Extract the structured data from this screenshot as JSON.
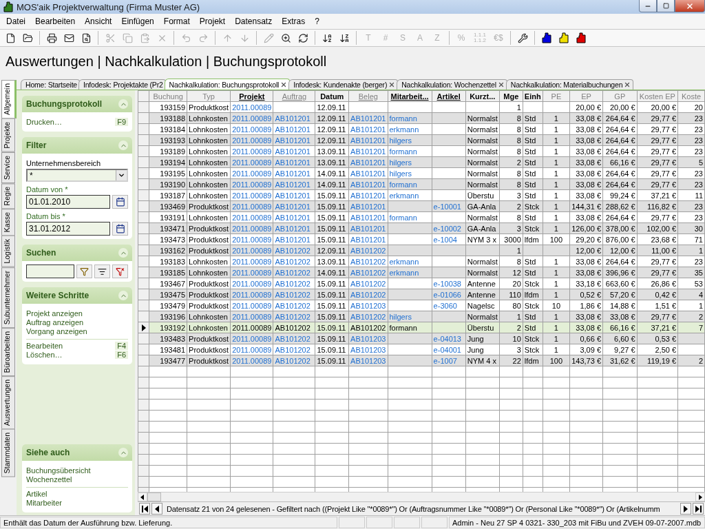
{
  "window": {
    "title": "MOS'aik Projektverwaltung (Firma Muster AG)"
  },
  "menu": [
    "Datei",
    "Bearbeiten",
    "Ansicht",
    "Einfügen",
    "Format",
    "Projekt",
    "Datensatz",
    "Extras",
    "?"
  ],
  "toolbar": [
    {
      "kind": "icon",
      "disabled": false
    },
    {
      "kind": "icon",
      "disabled": false
    },
    {
      "kind": "separator"
    },
    {
      "kind": "icon",
      "disabled": false
    },
    {
      "kind": "icon",
      "disabled": false
    },
    {
      "kind": "icon",
      "disabled": false
    },
    {
      "kind": "separator"
    },
    {
      "kind": "icon",
      "disabled": true
    },
    {
      "kind": "icon",
      "disabled": true
    },
    {
      "kind": "icon",
      "disabled": true
    },
    {
      "kind": "icon",
      "disabled": true
    },
    {
      "kind": "separator"
    },
    {
      "kind": "icon",
      "disabled": true
    },
    {
      "kind": "icon",
      "disabled": true
    },
    {
      "kind": "separator"
    },
    {
      "kind": "icon",
      "disabled": true
    },
    {
      "kind": "icon",
      "disabled": true
    },
    {
      "kind": "separator"
    },
    {
      "kind": "icon",
      "disabled": true
    },
    {
      "kind": "icon",
      "disabled": false
    },
    {
      "kind": "icon",
      "disabled": false
    },
    {
      "kind": "separator"
    },
    {
      "kind": "icon",
      "disabled": false
    },
    {
      "kind": "icon",
      "disabled": false
    },
    {
      "kind": "separator"
    },
    {
      "kind": "glyph",
      "label": "T",
      "disabled": true
    },
    {
      "kind": "glyph",
      "label": "#",
      "disabled": true
    },
    {
      "kind": "glyph",
      "label": "S",
      "disabled": true
    },
    {
      "kind": "glyph",
      "label": "A",
      "disabled": true
    },
    {
      "kind": "glyph",
      "label": "Z",
      "disabled": true
    },
    {
      "kind": "separator"
    },
    {
      "kind": "glyph",
      "label": "%",
      "disabled": true
    },
    {
      "kind": "glyph",
      "label": "1.1.1 1.1.2",
      "disabled": true
    },
    {
      "kind": "glyph",
      "label": "€$",
      "disabled": true
    },
    {
      "kind": "separator"
    },
    {
      "kind": "icon",
      "disabled": false
    },
    {
      "kind": "separator"
    },
    {
      "kind": "user",
      "color": "#0000e0"
    },
    {
      "kind": "user",
      "color": "#f0e000"
    },
    {
      "kind": "user",
      "color": "#e00000"
    }
  ],
  "page_title": "Auswertungen | Nachkalkulation | Buchungsprotokoll",
  "side_tabs": [
    {
      "label": "Allgemein",
      "selected": true
    },
    {
      "label": "Projekte",
      "selected": false
    },
    {
      "label": "Service",
      "selected": false
    },
    {
      "label": "Regie",
      "selected": false
    },
    {
      "label": "Kasse",
      "selected": false
    },
    {
      "label": "Logistik",
      "selected": false
    },
    {
      "label": "Subunternehmer",
      "selected": false
    },
    {
      "label": "Büroarbeiten",
      "selected": false
    },
    {
      "label": "Auswertungen",
      "selected": false
    },
    {
      "label": "Stammdaten",
      "selected": false
    }
  ],
  "doc_tabs": [
    {
      "label": "Home: Startseite",
      "selected": false,
      "closable": false
    },
    {
      "label": "Infodesk: Projektakte (Pr2",
      "selected": false,
      "closable": false
    },
    {
      "label": "Nachkalkulation: Buchungsprotokoll",
      "selected": true,
      "closable": true
    },
    {
      "label": "Infodesk: Kundenakte (berger)",
      "selected": false,
      "closable": true
    },
    {
      "label": "Nachkalkulation: Wochenzettel",
      "selected": false,
      "closable": true
    },
    {
      "label": "Nachkalkulation: Materialbuchungen",
      "selected": false,
      "closable": true
    }
  ],
  "side_panel": [
    {
      "kind": "links",
      "title": "Buchungsprotokoll",
      "expanded": true,
      "groups": [
        [
          {
            "label": "Drucken…",
            "shortcut": "F9"
          }
        ]
      ]
    },
    {
      "kind": "filter",
      "title": "Filter",
      "expanded": true,
      "fields": [
        {
          "kind": "select",
          "label": "Unternehmensbereich",
          "required": false,
          "value": "*"
        },
        {
          "kind": "date",
          "label": "Datum von *",
          "required": true,
          "value": "01.01.2010"
        },
        {
          "kind": "date",
          "label": "Datum bis *",
          "required": true,
          "value": "31.01.2012"
        }
      ]
    },
    {
      "kind": "search",
      "title": "Suchen",
      "expanded": true
    },
    {
      "kind": "links",
      "title": "Weitere Schritte",
      "expanded": true,
      "groups": [
        [
          {
            "label": "Projekt anzeigen"
          },
          {
            "label": "Auftrag anzeigen"
          },
          {
            "label": "Vorgang anzeigen"
          }
        ],
        [
          {
            "label": "Bearbeiten",
            "shortcut": "F4"
          },
          {
            "label": "Löschen…",
            "shortcut": "F6"
          }
        ]
      ]
    },
    {
      "kind": "spacer"
    },
    {
      "kind": "links",
      "title": "Siehe auch",
      "expanded": true,
      "groups": [
        [
          {
            "label": "Buchungsübersicht"
          },
          {
            "label": "Wochenzettel"
          }
        ],
        [
          {
            "label": "Artikel"
          },
          {
            "label": "Mitarbeiter"
          }
        ]
      ]
    }
  ],
  "table": {
    "columns": [
      {
        "label": "Buchung",
        "enabled": false,
        "linked": false
      },
      {
        "label": "Typ",
        "enabled": false,
        "linked": false
      },
      {
        "label": "Projekt",
        "enabled": true,
        "linked": true
      },
      {
        "label": "Auftrag",
        "enabled": false,
        "linked": true
      },
      {
        "label": "Datum",
        "enabled": true,
        "linked": false
      },
      {
        "label": "Beleg",
        "enabled": false,
        "linked": true
      },
      {
        "label": "Mitarbeit...",
        "enabled": true,
        "linked": true
      },
      {
        "label": "Artikel",
        "enabled": true,
        "linked": true
      },
      {
        "label": "Kurzt...",
        "enabled": true,
        "linked": false
      },
      {
        "label": "Mge",
        "enabled": true,
        "linked": false
      },
      {
        "label": "Einh",
        "enabled": true,
        "linked": false
      },
      {
        "label": "PE",
        "enabled": false,
        "linked": false
      },
      {
        "label": "EP",
        "enabled": false,
        "linked": false
      },
      {
        "label": "GP",
        "enabled": false,
        "linked": false
      },
      {
        "label": "Kosten EP",
        "enabled": false,
        "linked": false
      },
      {
        "label": "Koste",
        "enabled": false,
        "linked": false
      }
    ],
    "rows": [
      {
        "selected": false,
        "cells": [
          "193159",
          "Produktkost",
          "2011.00089",
          null,
          "12.09.11",
          null,
          null,
          null,
          null,
          "1",
          null,
          null,
          "20,00 €",
          "20,00 €",
          "20,00 €",
          "20"
        ]
      },
      {
        "selected": false,
        "cells": [
          "193188",
          "Lohnkosten",
          "2011.00089",
          "AB101201",
          "12.09.11",
          "AB101201",
          "formann",
          null,
          "Normalst",
          "8",
          "Std",
          "1",
          "33,08 €",
          "264,64 €",
          "29,77 €",
          "23"
        ]
      },
      {
        "selected": false,
        "cells": [
          "193184",
          "Lohnkosten",
          "2011.00089",
          "AB101201",
          "12.09.11",
          "AB101201",
          "erkmann",
          null,
          "Normalst",
          "8",
          "Std",
          "1",
          "33,08 €",
          "264,64 €",
          "29,77 €",
          "23"
        ]
      },
      {
        "selected": false,
        "cells": [
          "193193",
          "Lohnkosten",
          "2011.00089",
          "AB101201",
          "12.09.11",
          "AB101201",
          "hilgers",
          null,
          "Normalst",
          "8",
          "Std",
          "1",
          "33,08 €",
          "264,64 €",
          "29,77 €",
          "23"
        ]
      },
      {
        "selected": false,
        "cells": [
          "193189",
          "Lohnkosten",
          "2011.00089",
          "AB101201",
          "13.09.11",
          "AB101201",
          "formann",
          null,
          "Normalst",
          "8",
          "Std",
          "1",
          "33,08 €",
          "264,64 €",
          "29,77 €",
          "23"
        ]
      },
      {
        "selected": false,
        "cells": [
          "193194",
          "Lohnkosten",
          "2011.00089",
          "AB101201",
          "13.09.11",
          "AB101201",
          "hilgers",
          null,
          "Normalst",
          "2",
          "Std",
          "1",
          "33,08 €",
          "66,16 €",
          "29,77 €",
          "5"
        ]
      },
      {
        "selected": false,
        "cells": [
          "193195",
          "Lohnkosten",
          "2011.00089",
          "AB101201",
          "14.09.11",
          "AB101201",
          "hilgers",
          null,
          "Normalst",
          "8",
          "Std",
          "1",
          "33,08 €",
          "264,64 €",
          "29,77 €",
          "23"
        ]
      },
      {
        "selected": false,
        "cells": [
          "193190",
          "Lohnkosten",
          "2011.00089",
          "AB101201",
          "14.09.11",
          "AB101201",
          "formann",
          null,
          "Normalst",
          "8",
          "Std",
          "1",
          "33,08 €",
          "264,64 €",
          "29,77 €",
          "23"
        ]
      },
      {
        "selected": false,
        "cells": [
          "193187",
          "Lohnkosten",
          "2011.00089",
          "AB101201",
          "15.09.11",
          "AB101201",
          "erkmann",
          null,
          "Überstu",
          "3",
          "Std",
          "1",
          "33,08 €",
          "99,24 €",
          "37,21 €",
          "11"
        ]
      },
      {
        "selected": false,
        "cells": [
          "193469",
          "Produktkost",
          "2011.00089",
          "AB101201",
          "15.09.11",
          "AB101201",
          null,
          "e-10001",
          "GA-Anla",
          "2",
          "Stck",
          "1",
          "144,31 €",
          "288,62 €",
          "116,82 €",
          "23"
        ]
      },
      {
        "selected": false,
        "cells": [
          "193191",
          "Lohnkosten",
          "2011.00089",
          "AB101201",
          "15.09.11",
          "AB101201",
          "formann",
          null,
          "Normalst",
          "8",
          "Std",
          "1",
          "33,08 €",
          "264,64 €",
          "29,77 €",
          "23"
        ]
      },
      {
        "selected": false,
        "cells": [
          "193471",
          "Produktkost",
          "2011.00089",
          "AB101201",
          "15.09.11",
          "AB101201",
          null,
          "e-10002",
          "GA-Anla",
          "3",
          "Stck",
          "1",
          "126,00 €",
          "378,00 €",
          "102,00 €",
          "30"
        ]
      },
      {
        "selected": false,
        "cells": [
          "193473",
          "Produktkost",
          "2011.00089",
          "AB101201",
          "15.09.11",
          "AB101201",
          null,
          "e-1004",
          "NYM 3 x",
          "3000",
          "lfdm",
          "100",
          "29,20 €",
          "876,00 €",
          "23,68 €",
          "71"
        ]
      },
      {
        "selected": false,
        "cells": [
          "193162",
          "Produktkost",
          "2011.00089",
          "AB101202",
          "12.09.11",
          "AB101202",
          null,
          null,
          null,
          "1",
          null,
          null,
          "12,00 €",
          "12,00 €",
          "11,00 €",
          "1"
        ]
      },
      {
        "selected": false,
        "cells": [
          "193183",
          "Lohnkosten",
          "2011.00089",
          "AB101202",
          "13.09.11",
          "AB101202",
          "erkmann",
          null,
          "Normalst",
          "8",
          "Std",
          "1",
          "33,08 €",
          "264,64 €",
          "29,77 €",
          "23"
        ]
      },
      {
        "selected": false,
        "cells": [
          "193185",
          "Lohnkosten",
          "2011.00089",
          "AB101202",
          "14.09.11",
          "AB101202",
          "erkmann",
          null,
          "Normalst",
          "12",
          "Std",
          "1",
          "33,08 €",
          "396,96 €",
          "29,77 €",
          "35"
        ]
      },
      {
        "selected": false,
        "cells": [
          "193467",
          "Produktkost",
          "2011.00089",
          "AB101202",
          "15.09.11",
          "AB101202",
          null,
          "e-10038",
          "Antenne",
          "20",
          "Stck",
          "1",
          "33,18 €",
          "663,60 €",
          "26,86 €",
          "53"
        ]
      },
      {
        "selected": false,
        "cells": [
          "193475",
          "Produktkost",
          "2011.00089",
          "AB101202",
          "15.09.11",
          "AB101202",
          null,
          "e-01066",
          "Antenne",
          "110",
          "lfdm",
          "1",
          "0,52 €",
          "57,20 €",
          "0,42 €",
          "4"
        ]
      },
      {
        "selected": false,
        "cells": [
          "193479",
          "Produktkost",
          "2011.00089",
          "AB101202",
          "15.09.11",
          "AB101203",
          null,
          "e-3060",
          "Nagelsc",
          "80",
          "Stck",
          "10",
          "1,86 €",
          "14,88 €",
          "1,51 €",
          "1"
        ]
      },
      {
        "selected": false,
        "cells": [
          "193196",
          "Lohnkosten",
          "2011.00089",
          "AB101202",
          "15.09.11",
          "AB101202",
          "hilgers",
          null,
          "Normalst",
          "1",
          "Std",
          "1",
          "33,08 €",
          "33,08 €",
          "29,77 €",
          "2"
        ]
      },
      {
        "selected": true,
        "cells": [
          "193192",
          "Lohnkosten",
          "2011.00089",
          "AB101202",
          "15.09.11",
          "AB101202",
          "formann",
          null,
          "Überstu",
          "2",
          "Std",
          "1",
          "33,08 €",
          "66,16 €",
          "37,21 €",
          "7"
        ]
      },
      {
        "selected": false,
        "cells": [
          "193483",
          "Produktkost",
          "2011.00089",
          "AB101202",
          "15.09.11",
          "AB101203",
          null,
          "e-04013",
          "Jung",
          "10",
          "Stck",
          "1",
          "0,66 €",
          "6,60 €",
          "0,53 €",
          null
        ]
      },
      {
        "selected": false,
        "cells": [
          "193481",
          "Produktkost",
          "2011.00089",
          "AB101202",
          "15.09.11",
          "AB101203",
          null,
          "e-04001",
          "Jung",
          "3",
          "Stck",
          "1",
          "3,09 €",
          "9,27 €",
          "2,50 €",
          null
        ]
      },
      {
        "selected": false,
        "cells": [
          "193477",
          "Produktkost",
          "2011.00089",
          "AB101202",
          "15.09.11",
          "AB101203",
          null,
          "e-1007",
          "NYM 4 x",
          "22",
          "lfdm",
          "100",
          "143,73 €",
          "31,62 €",
          "119,19 €",
          "2"
        ]
      }
    ]
  },
  "record_nav": {
    "text": "Datensatz 21 von 24 gelesenen - Gefiltert nach  ((Projekt Like \"*0089*\") Or (Auftragsnummer Like \"*0089*\") Or (Personal Like \"*0089*\") Or (Artikelnumm"
  },
  "status_bar": {
    "hint": "Enthält das Datum der Ausführung bzw. Lieferung.",
    "database": "Admin - Neu 27 SP 4 0321- 330_203 mit FiBu und ZVEH 09-07-2007.mdb"
  }
}
